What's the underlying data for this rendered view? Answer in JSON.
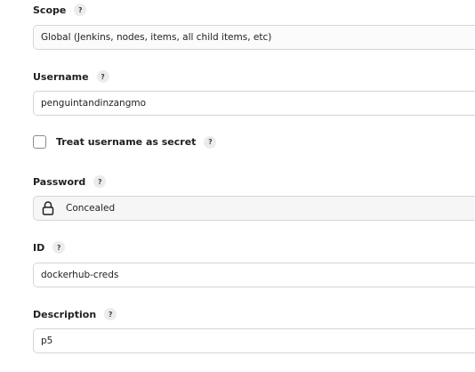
{
  "scope": {
    "label": "Scope",
    "help": "?",
    "value": "Global (Jenkins, nodes, items, all child items, etc)"
  },
  "username": {
    "label": "Username",
    "help": "?",
    "value": "penguintandinzangmo"
  },
  "secret_checkbox": {
    "label": "Treat username as secret",
    "help": "?",
    "checked": false
  },
  "password": {
    "label": "Password",
    "help": "?",
    "value": "Concealed",
    "icon": "lock-icon"
  },
  "id": {
    "label": "ID",
    "help": "?",
    "value": "dockerhub-creds"
  },
  "description": {
    "label": "Description",
    "help": "?",
    "value": "p5"
  }
}
